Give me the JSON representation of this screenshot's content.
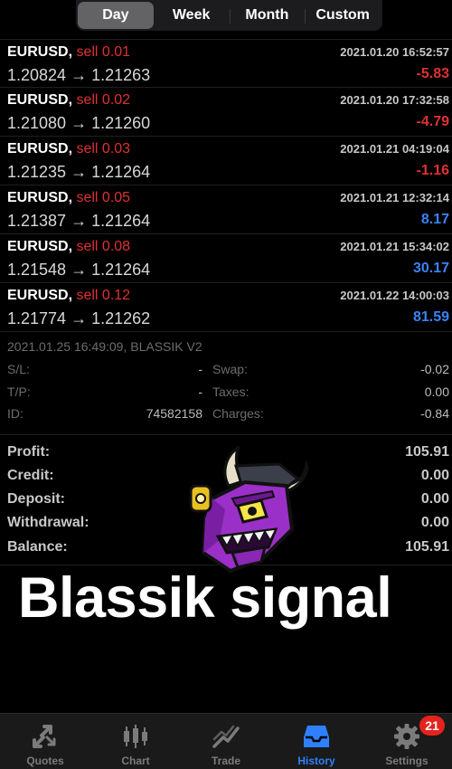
{
  "segments": [
    "Day",
    "Week",
    "Month",
    "Custom"
  ],
  "active_segment": "Day",
  "deals": [
    {
      "symbol": "EURUSD,",
      "side": "sell 0.01",
      "time": "2021.01.20 16:52:57",
      "prices": "1.20824 → 1.21263",
      "profit": "-5.83",
      "profit_sign": "neg"
    },
    {
      "symbol": "EURUSD,",
      "side": "sell 0.02",
      "time": "2021.01.20 17:32:58",
      "prices": "1.21080 → 1.21260",
      "profit": "-4.79",
      "profit_sign": "neg"
    },
    {
      "symbol": "EURUSD,",
      "side": "sell 0.03",
      "time": "2021.01.21 04:19:04",
      "prices": "1.21235 → 1.21264",
      "profit": "-1.16",
      "profit_sign": "neg"
    },
    {
      "symbol": "EURUSD,",
      "side": "sell 0.05",
      "time": "2021.01.21 12:32:14",
      "prices": "1.21387 → 1.21264",
      "profit": "8.17",
      "profit_sign": "pos"
    },
    {
      "symbol": "EURUSD,",
      "side": "sell 0.08",
      "time": "2021.01.21 15:34:02",
      "prices": "1.21548 → 1.21264",
      "profit": "30.17",
      "profit_sign": "pos"
    },
    {
      "symbol": "EURUSD,",
      "side": "sell 0.12",
      "time": "2021.01.22 14:00:03",
      "prices": "1.21774 → 1.21262",
      "profit": "81.59",
      "profit_sign": "pos"
    }
  ],
  "details": {
    "header": "2021.01.25 16:49:09, BLASSIK V2",
    "sl_label": "S/L:",
    "sl_value": "-",
    "swap_label": "Swap:",
    "swap_value": "-0.02",
    "tp_label": "T/P:",
    "tp_value": "-",
    "taxes_label": "Taxes:",
    "taxes_value": "0.00",
    "id_label": "ID:",
    "id_value": "74582158",
    "charges_label": "Charges:",
    "charges_value": "-0.84"
  },
  "summary": [
    {
      "label": "Profit:",
      "value": "105.91"
    },
    {
      "label": "Credit:",
      "value": "0.00"
    },
    {
      "label": "Deposit:",
      "value": "0.00"
    },
    {
      "label": "Withdrawal:",
      "value": "0.00"
    },
    {
      "label": "Balance:",
      "value": "105.91"
    }
  ],
  "overlay_text": "Blassik signal",
  "tabs": [
    {
      "label": "Quotes",
      "icon": "quotes-arrows-icon"
    },
    {
      "label": "Chart",
      "icon": "candlestick-chart-icon"
    },
    {
      "label": "Trade",
      "icon": "trade-chart-icon"
    },
    {
      "label": "History",
      "icon": "history-inbox-icon"
    },
    {
      "label": "Settings",
      "icon": "settings-gear-icon"
    }
  ],
  "active_tab": "History",
  "settings_badge": "21",
  "colors": {
    "negative": "#e03131",
    "positive": "#3b82f6",
    "active_tab": "#2f80ff",
    "badge": "#e5231c",
    "logo_purple": "#9b30c8"
  }
}
